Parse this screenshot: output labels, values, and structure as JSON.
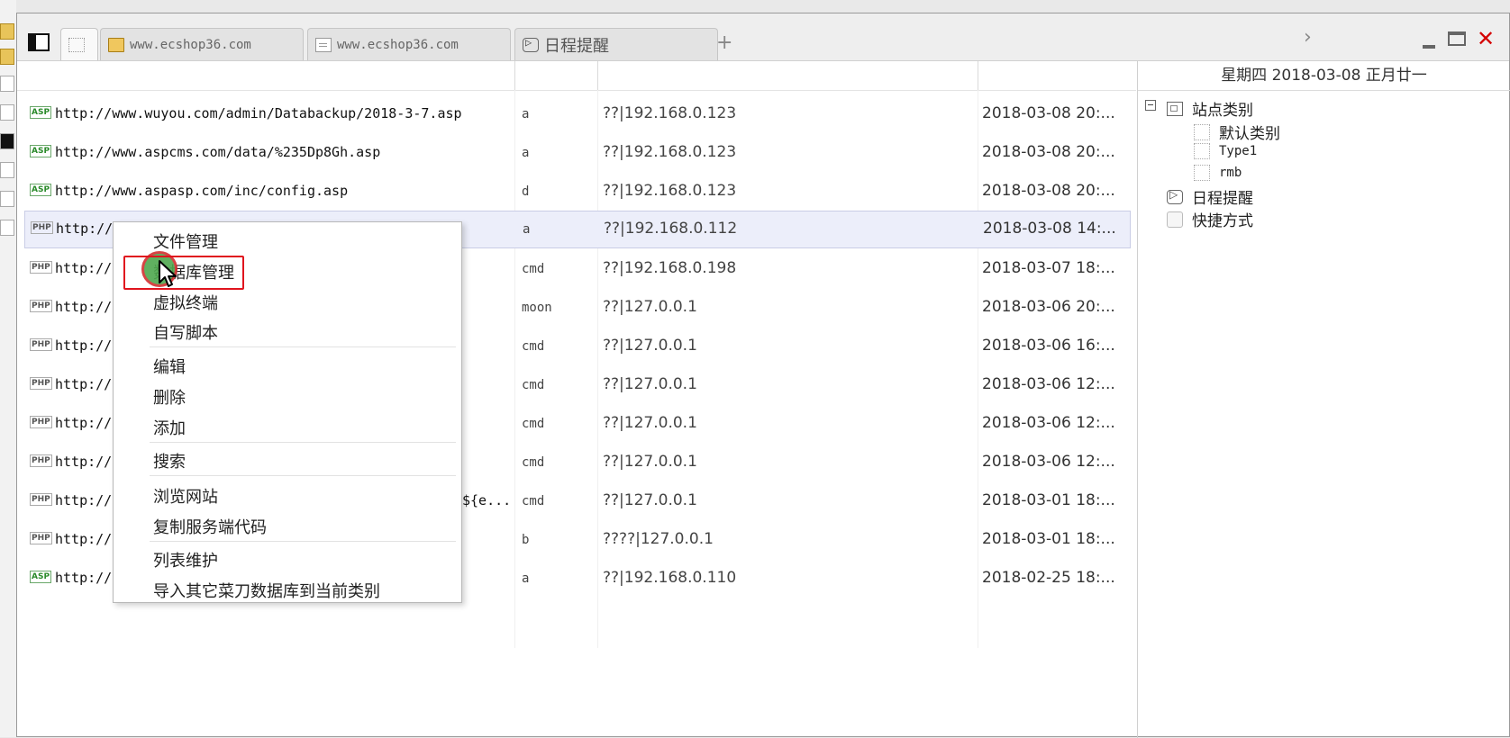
{
  "window": {
    "tabs": [
      {
        "label": "",
        "icon": "blank-icon"
      },
      {
        "label": "www.ecshop36.com",
        "icon": "folder-icon"
      },
      {
        "label": "www.ecshop36.com",
        "icon": "document-icon"
      },
      {
        "label": "日程提醒",
        "icon": "schedule-icon"
      }
    ],
    "add_tab": "+",
    "nav_next": "›"
  },
  "rows": [
    {
      "type": "ASP",
      "url": "http://www.wuyou.com/admin/Databackup/2018-3-7.asp",
      "note": "a",
      "ip": "??|192.168.0.123",
      "time": "2018-03-08 20:..."
    },
    {
      "type": "ASP",
      "url": "http://www.aspcms.com/data/%235Dp8Gh.asp",
      "note": "a",
      "ip": "??|192.168.0.123",
      "time": "2018-03-08 20:..."
    },
    {
      "type": "ASP",
      "url": "http://www.aspasp.com/inc/config.asp",
      "note": "d",
      "ip": "??|192.168.0.123",
      "time": "2018-03-08 20:..."
    },
    {
      "type": "PHP",
      "url": "http://",
      "note": "a",
      "ip": "??|192.168.0.112",
      "time": "2018-03-08 14:..."
    },
    {
      "type": "PHP",
      "url": "http://",
      "note": "cmd",
      "ip": "??|192.168.0.198",
      "time": "2018-03-07 18:..."
    },
    {
      "type": "PHP",
      "url": "http://",
      "note": "moon",
      "ip": "??|127.0.0.1",
      "time": "2018-03-06 20:..."
    },
    {
      "type": "PHP",
      "url": "http://",
      "note": "cmd",
      "ip": "??|127.0.0.1",
      "time": "2018-03-06 16:..."
    },
    {
      "type": "PHP",
      "url": "http://",
      "note": "cmd",
      "ip": "??|127.0.0.1",
      "time": "2018-03-06 12:..."
    },
    {
      "type": "PHP",
      "url": "http://",
      "note": "cmd",
      "ip": "??|127.0.0.1",
      "time": "2018-03-06 12:..."
    },
    {
      "type": "PHP",
      "url": "http://",
      "note": "cmd",
      "ip": "??|127.0.0.1",
      "time": "2018-03-06 12:..."
    },
    {
      "type": "PHP",
      "url": "http://",
      "note": "cmd",
      "ip": "??|127.0.0.1",
      "time": "2018-03-01 18:..."
    },
    {
      "type": "PHP",
      "url": "http://",
      "note": "b",
      "ip": "????|127.0.0.1",
      "time": "2018-03-01 18:..."
    },
    {
      "type": "ASP",
      "url": "http://",
      "note": "a",
      "ip": "??|192.168.0.110",
      "time": "2018-02-25 18:..."
    }
  ],
  "row_tail_fragment": "${e...",
  "sidebar": {
    "date": "星期四 2018-03-08 正月廿一",
    "tree": {
      "root": "站点类别",
      "children": [
        "默认类别",
        "Type1",
        "rmb"
      ],
      "schedule": "日程提醒",
      "shortcuts": "快捷方式"
    }
  },
  "context_menu": {
    "items": [
      "文件管理",
      "数据库管理",
      "虚拟终端",
      "自写脚本",
      "编辑",
      "删除",
      "添加",
      "搜索",
      "浏览网站",
      "复制服务端代码",
      "列表维护",
      "导入其它菜刀数据库到当前类别"
    ],
    "highlighted": "数据库管理"
  }
}
